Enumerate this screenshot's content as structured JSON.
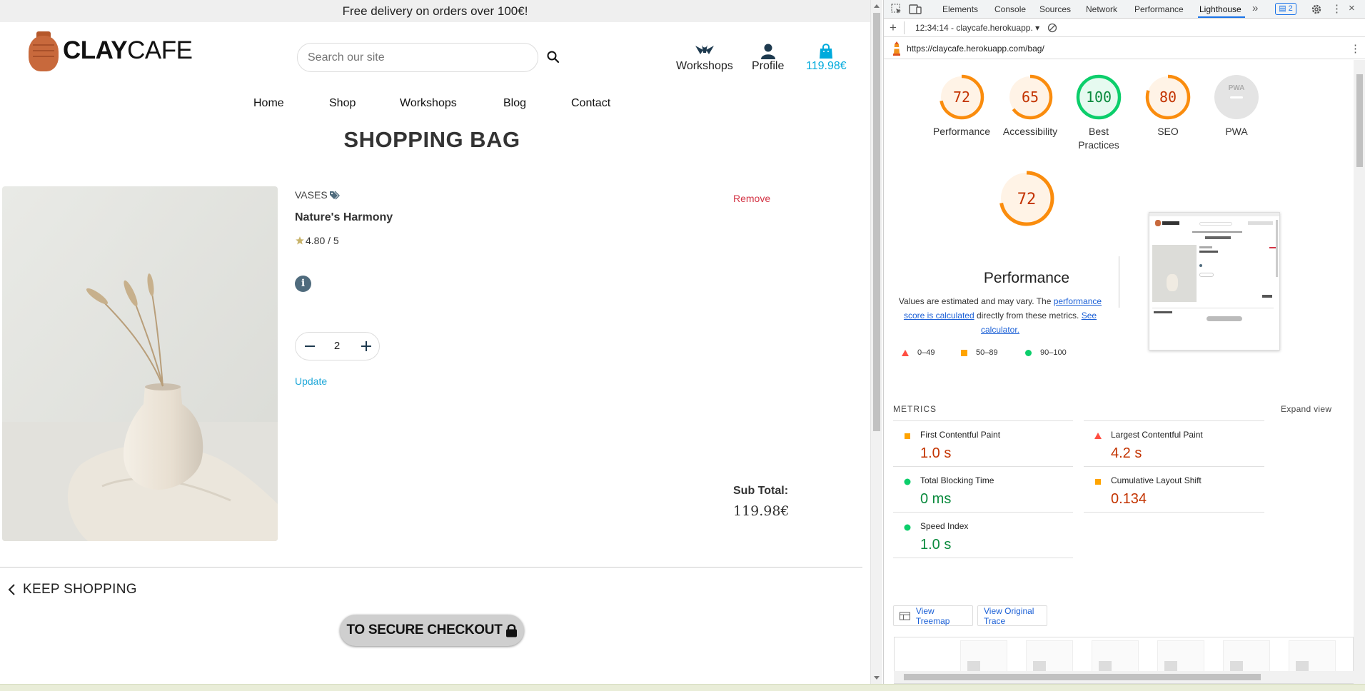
{
  "site": {
    "promo": "Free delivery on orders over 100€!",
    "logo": {
      "bold": "CLAY",
      "light": "CAFE"
    },
    "search": {
      "placeholder": "Search our site"
    },
    "header_links": [
      {
        "label": "Workshops",
        "icon": "workshop-icon"
      },
      {
        "label": "Profile",
        "icon": "user-icon"
      },
      {
        "label": "119.98€",
        "icon": "shopping-bag-icon"
      }
    ],
    "nav": [
      "Home",
      "Shop",
      "Workshops",
      "Blog",
      "Contact"
    ],
    "page_title": "SHOPPING BAG",
    "item": {
      "category": "VASES",
      "name": "Nature's Harmony",
      "rating": "4.80 / 5",
      "quantity": "2",
      "update_label": "Update",
      "remove_label": "Remove"
    },
    "subtotal_label": "Sub Total:",
    "subtotal_value": "119.98€",
    "keep_shopping": "KEEP SHOPPING",
    "checkout": "TO SECURE CHECKOUT",
    "colors": {
      "accent": "#00aadc",
      "remove": "#d33344",
      "logo_pot": "#c8693c"
    }
  },
  "devtools": {
    "tabs": [
      "Elements",
      "Console",
      "Sources",
      "Network",
      "Performance",
      "Lighthouse"
    ],
    "active_tab": "Lighthouse",
    "issues_count": "2",
    "report_select": "12:34:14 - claycafe.herokuapp.",
    "url": "https://claycafe.herokuapp.com/bag/",
    "scores": [
      {
        "label": "Performance",
        "value": "72",
        "score": 72,
        "color": "#fa8c0d"
      },
      {
        "label": "Accessibility",
        "value": "65",
        "score": 65,
        "color": "#fa8c0d"
      },
      {
        "label": "Best Practices",
        "value": "100",
        "score": 100,
        "color": "#0cce6b"
      },
      {
        "label": "SEO",
        "value": "80",
        "score": 80,
        "color": "#fa8c0d"
      },
      {
        "label": "PWA",
        "value": "",
        "score": 0,
        "color": "#cfcfcf"
      }
    ],
    "perf": {
      "score": "72",
      "title": "Performance",
      "desc_1": "Values are estimated and may vary. The ",
      "desc_link1": "performance score is calculated",
      "desc_2": " directly from these metrics. ",
      "desc_link2": "See calculator."
    },
    "legend": [
      "0–49",
      "50–89",
      "90–100"
    ],
    "metrics_header": "METRICS",
    "expand_view": "Expand view",
    "metrics": [
      {
        "label": "First Contentful Paint",
        "value": "1.0 s",
        "status": "average"
      },
      {
        "label": "Largest Contentful Paint",
        "value": "4.2 s",
        "status": "fail"
      },
      {
        "label": "Total Blocking Time",
        "value": "0 ms",
        "status": "pass"
      },
      {
        "label": "Cumulative Layout Shift",
        "value": "0.134",
        "status": "average"
      },
      {
        "label": "Speed Index",
        "value": "1.0 s",
        "status": "pass"
      }
    ],
    "buttons": {
      "treemap": "View Treemap",
      "trace": "View Original Trace"
    },
    "status_colors": {
      "pass": "#0cce6b",
      "average": "#ffa400",
      "fail": "#ff4e42",
      "pass_text": "#0a8a3d",
      "fail_text": "#c33300"
    }
  }
}
